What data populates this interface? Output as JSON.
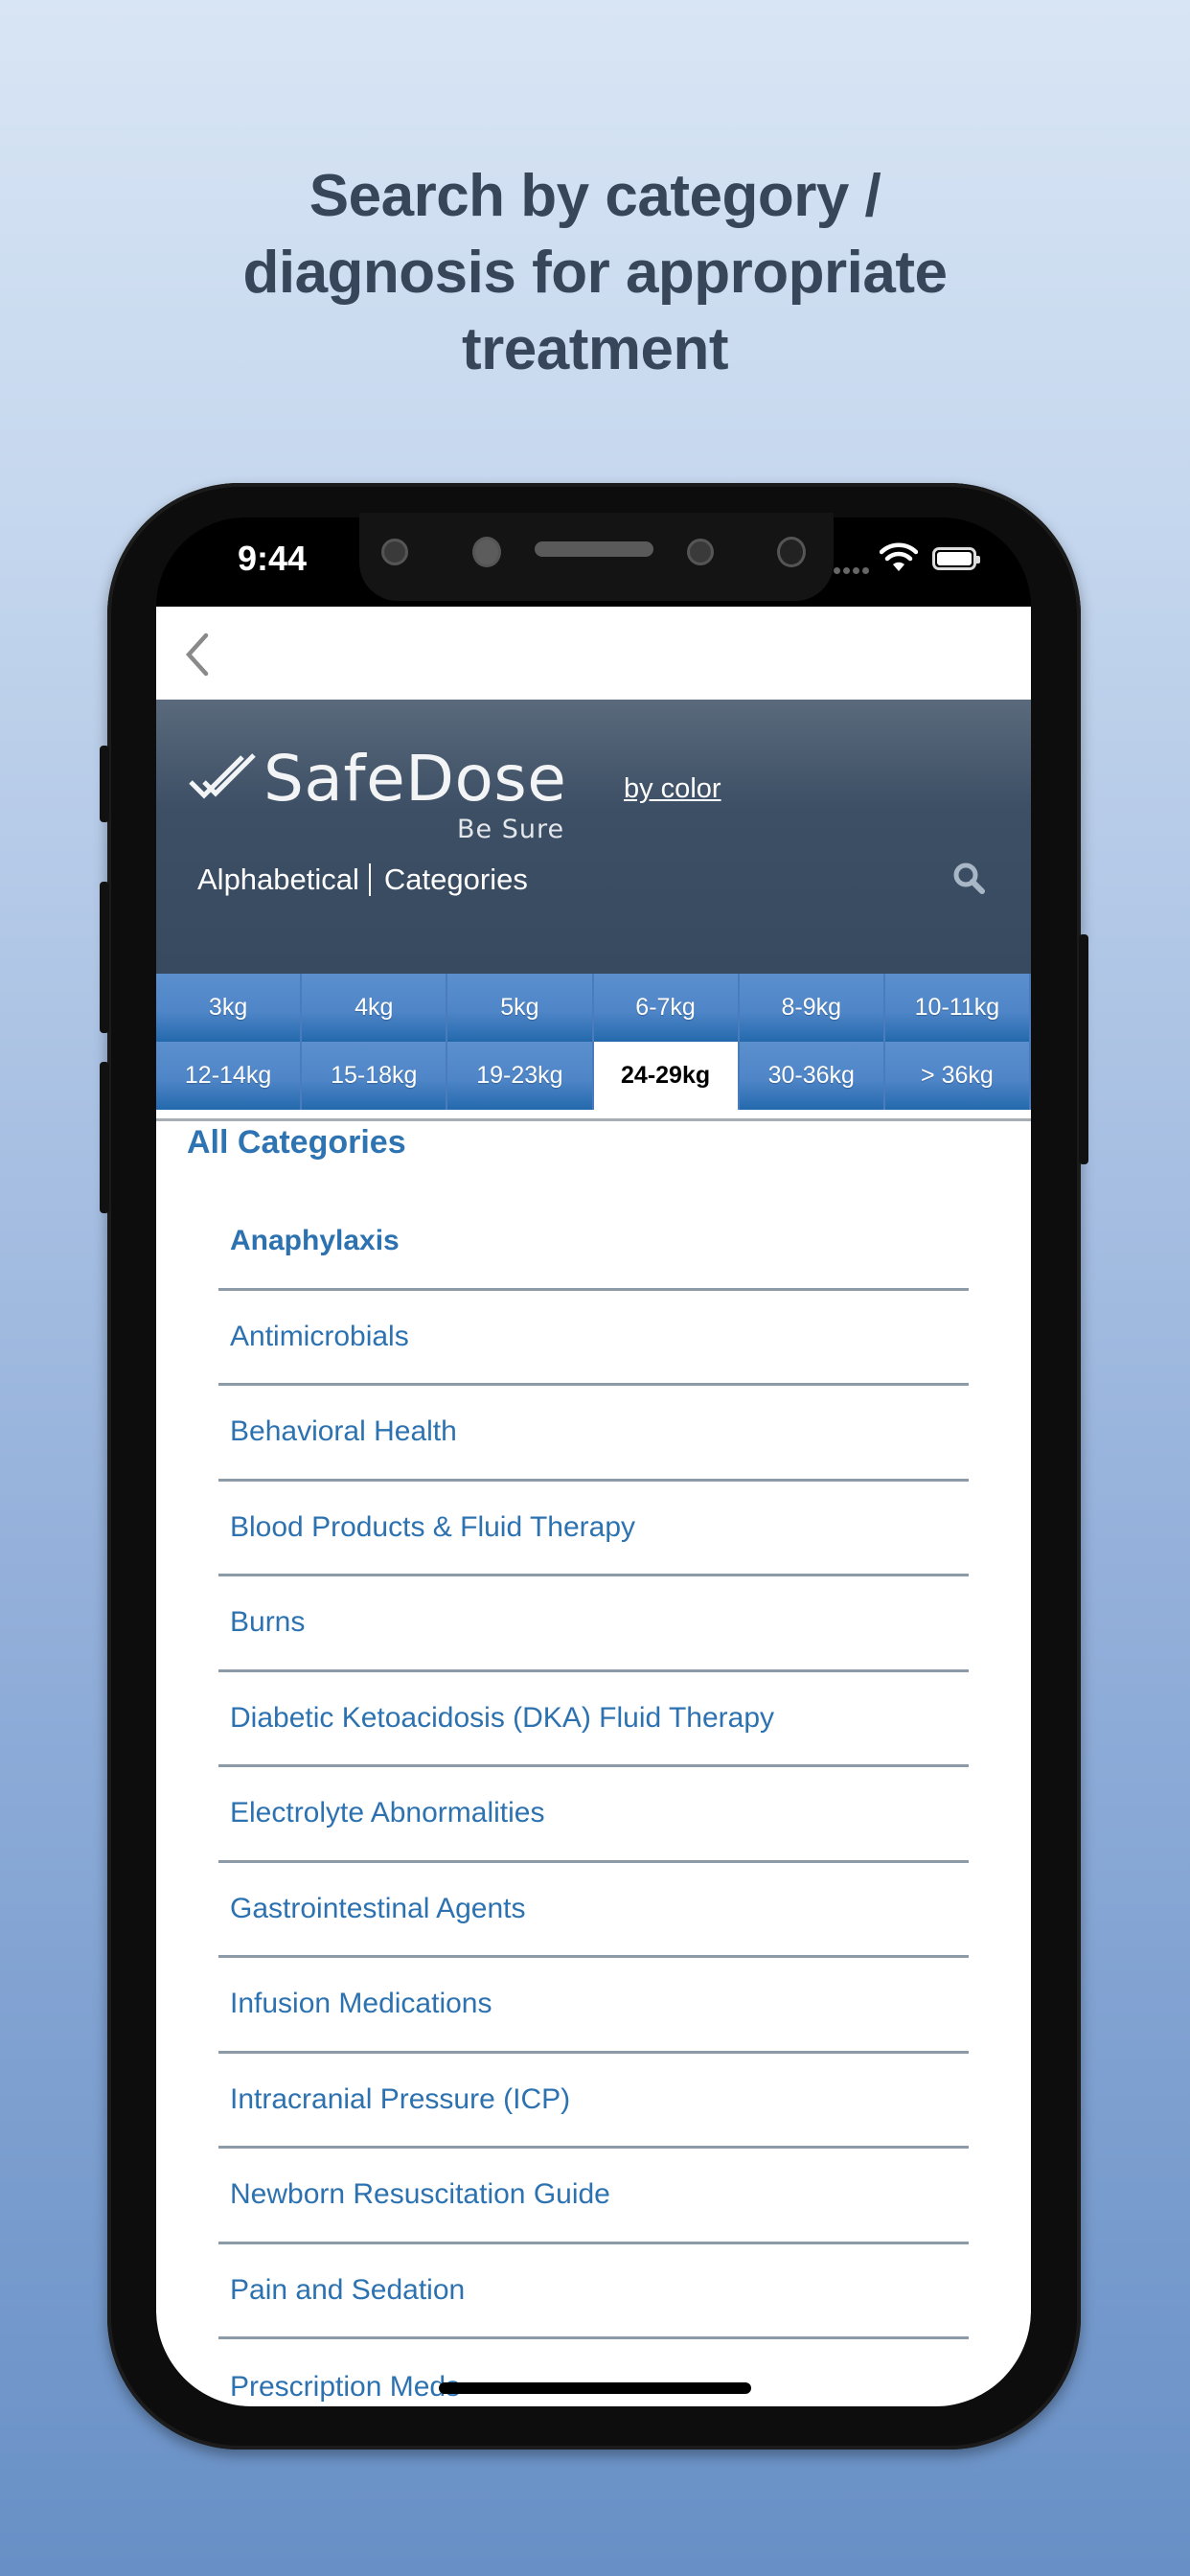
{
  "headline": {
    "line1": "Search by category /",
    "line2": "diagnosis for appropriate",
    "line3": "treatment"
  },
  "status_bar": {
    "time": "9:44",
    "icons": [
      "wifi-icon",
      "battery-icon"
    ]
  },
  "nav": {
    "back_icon": "chevron-left-icon"
  },
  "header": {
    "brand": "SafeDose",
    "tagline": "Be Sure",
    "by_color_link": "by color",
    "view_tabs": [
      {
        "label": "Alphabetical"
      },
      {
        "label": "Categories"
      }
    ],
    "search_icon": "search-icon"
  },
  "weights": {
    "selected": "24-29kg",
    "items": [
      {
        "label": "3kg"
      },
      {
        "label": "4kg"
      },
      {
        "label": "5kg"
      },
      {
        "label": "6-7kg"
      },
      {
        "label": "8-9kg"
      },
      {
        "label": "10-11kg"
      },
      {
        "label": "12-14kg"
      },
      {
        "label": "15-18kg"
      },
      {
        "label": "19-23kg"
      },
      {
        "label": "24-29kg"
      },
      {
        "label": "30-36kg"
      },
      {
        "label": "> 36kg"
      }
    ]
  },
  "categories": {
    "title": "All Categories",
    "items": [
      {
        "label": "Anaphylaxis",
        "bold": true
      },
      {
        "label": "Antimicrobials"
      },
      {
        "label": "Behavioral Health"
      },
      {
        "label": "Blood Products & Fluid Therapy"
      },
      {
        "label": "Burns"
      },
      {
        "label": "Diabetic Ketoacidosis (DKA) Fluid Therapy"
      },
      {
        "label": "Electrolyte Abnormalities"
      },
      {
        "label": "Gastrointestinal Agents"
      },
      {
        "label": "Infusion Medications"
      },
      {
        "label": "Intracranial Pressure (ICP)"
      },
      {
        "label": "Newborn Resuscitation Guide"
      },
      {
        "label": "Pain and Sedation"
      },
      {
        "label": "Prescription Meds"
      }
    ]
  },
  "colors": {
    "header_dark": "#3d4f65",
    "weight_blue": "#4f86c8",
    "link_blue": "#2d72b0",
    "headline": "#374759"
  }
}
